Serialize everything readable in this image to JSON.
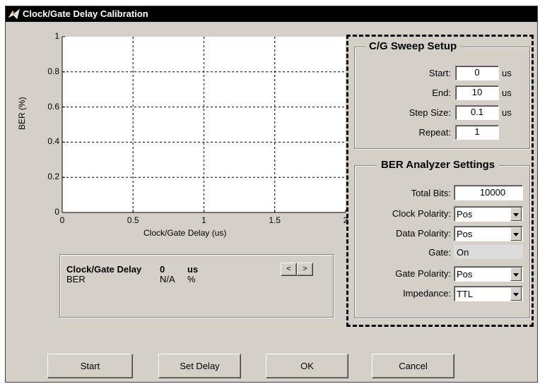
{
  "window": {
    "title": "Clock/Gate Delay Calibration"
  },
  "plot": {
    "xlabel": "Clock/Gate Delay (us)",
    "ylabel": "BER (%)",
    "xticks": [
      "0",
      "0.5",
      "1",
      "1.5",
      "2"
    ],
    "yticks": [
      "1",
      "0.8",
      "0.6",
      "0.4",
      "0.2",
      "0"
    ]
  },
  "chart_data": {
    "type": "line",
    "xlabel": "Clock/Gate Delay (us)",
    "ylabel": "BER (%)",
    "xlim": [
      0,
      2
    ],
    "ylim": [
      0,
      1
    ],
    "grid": true,
    "series": []
  },
  "readout": {
    "delay_label": "Clock/Gate Delay",
    "delay_value": "0",
    "delay_unit": "us",
    "ber_label": "BER",
    "ber_value": "N/A",
    "ber_unit": "%",
    "prev_label": "<",
    "next_label": ">"
  },
  "sweep": {
    "title": "C/G Sweep Setup",
    "start_label": "Start:",
    "start_value": "0",
    "start_unit": "us",
    "end_label": "End:",
    "end_value": "10",
    "end_unit": "us",
    "step_label": "Step Size:",
    "step_value": "0.1",
    "step_unit": "us",
    "repeat_label": "Repeat:",
    "repeat_value": "1"
  },
  "ber": {
    "title": "BER Analyzer Settings",
    "total_bits_label": "Total Bits:",
    "total_bits_value": "10000",
    "clock_polarity_label": "Clock Polarity:",
    "clock_polarity_value": "Pos",
    "data_polarity_label": "Data Polarity:",
    "data_polarity_value": "Pos",
    "gate_label": "Gate:",
    "gate_value": "On",
    "gate_polarity_label": "Gate Polarity:",
    "gate_polarity_value": "Pos",
    "impedance_label": "Impedance:",
    "impedance_value": "TTL"
  },
  "buttons": {
    "start": "Start",
    "set_delay": "Set Delay",
    "ok": "OK",
    "cancel": "Cancel"
  }
}
